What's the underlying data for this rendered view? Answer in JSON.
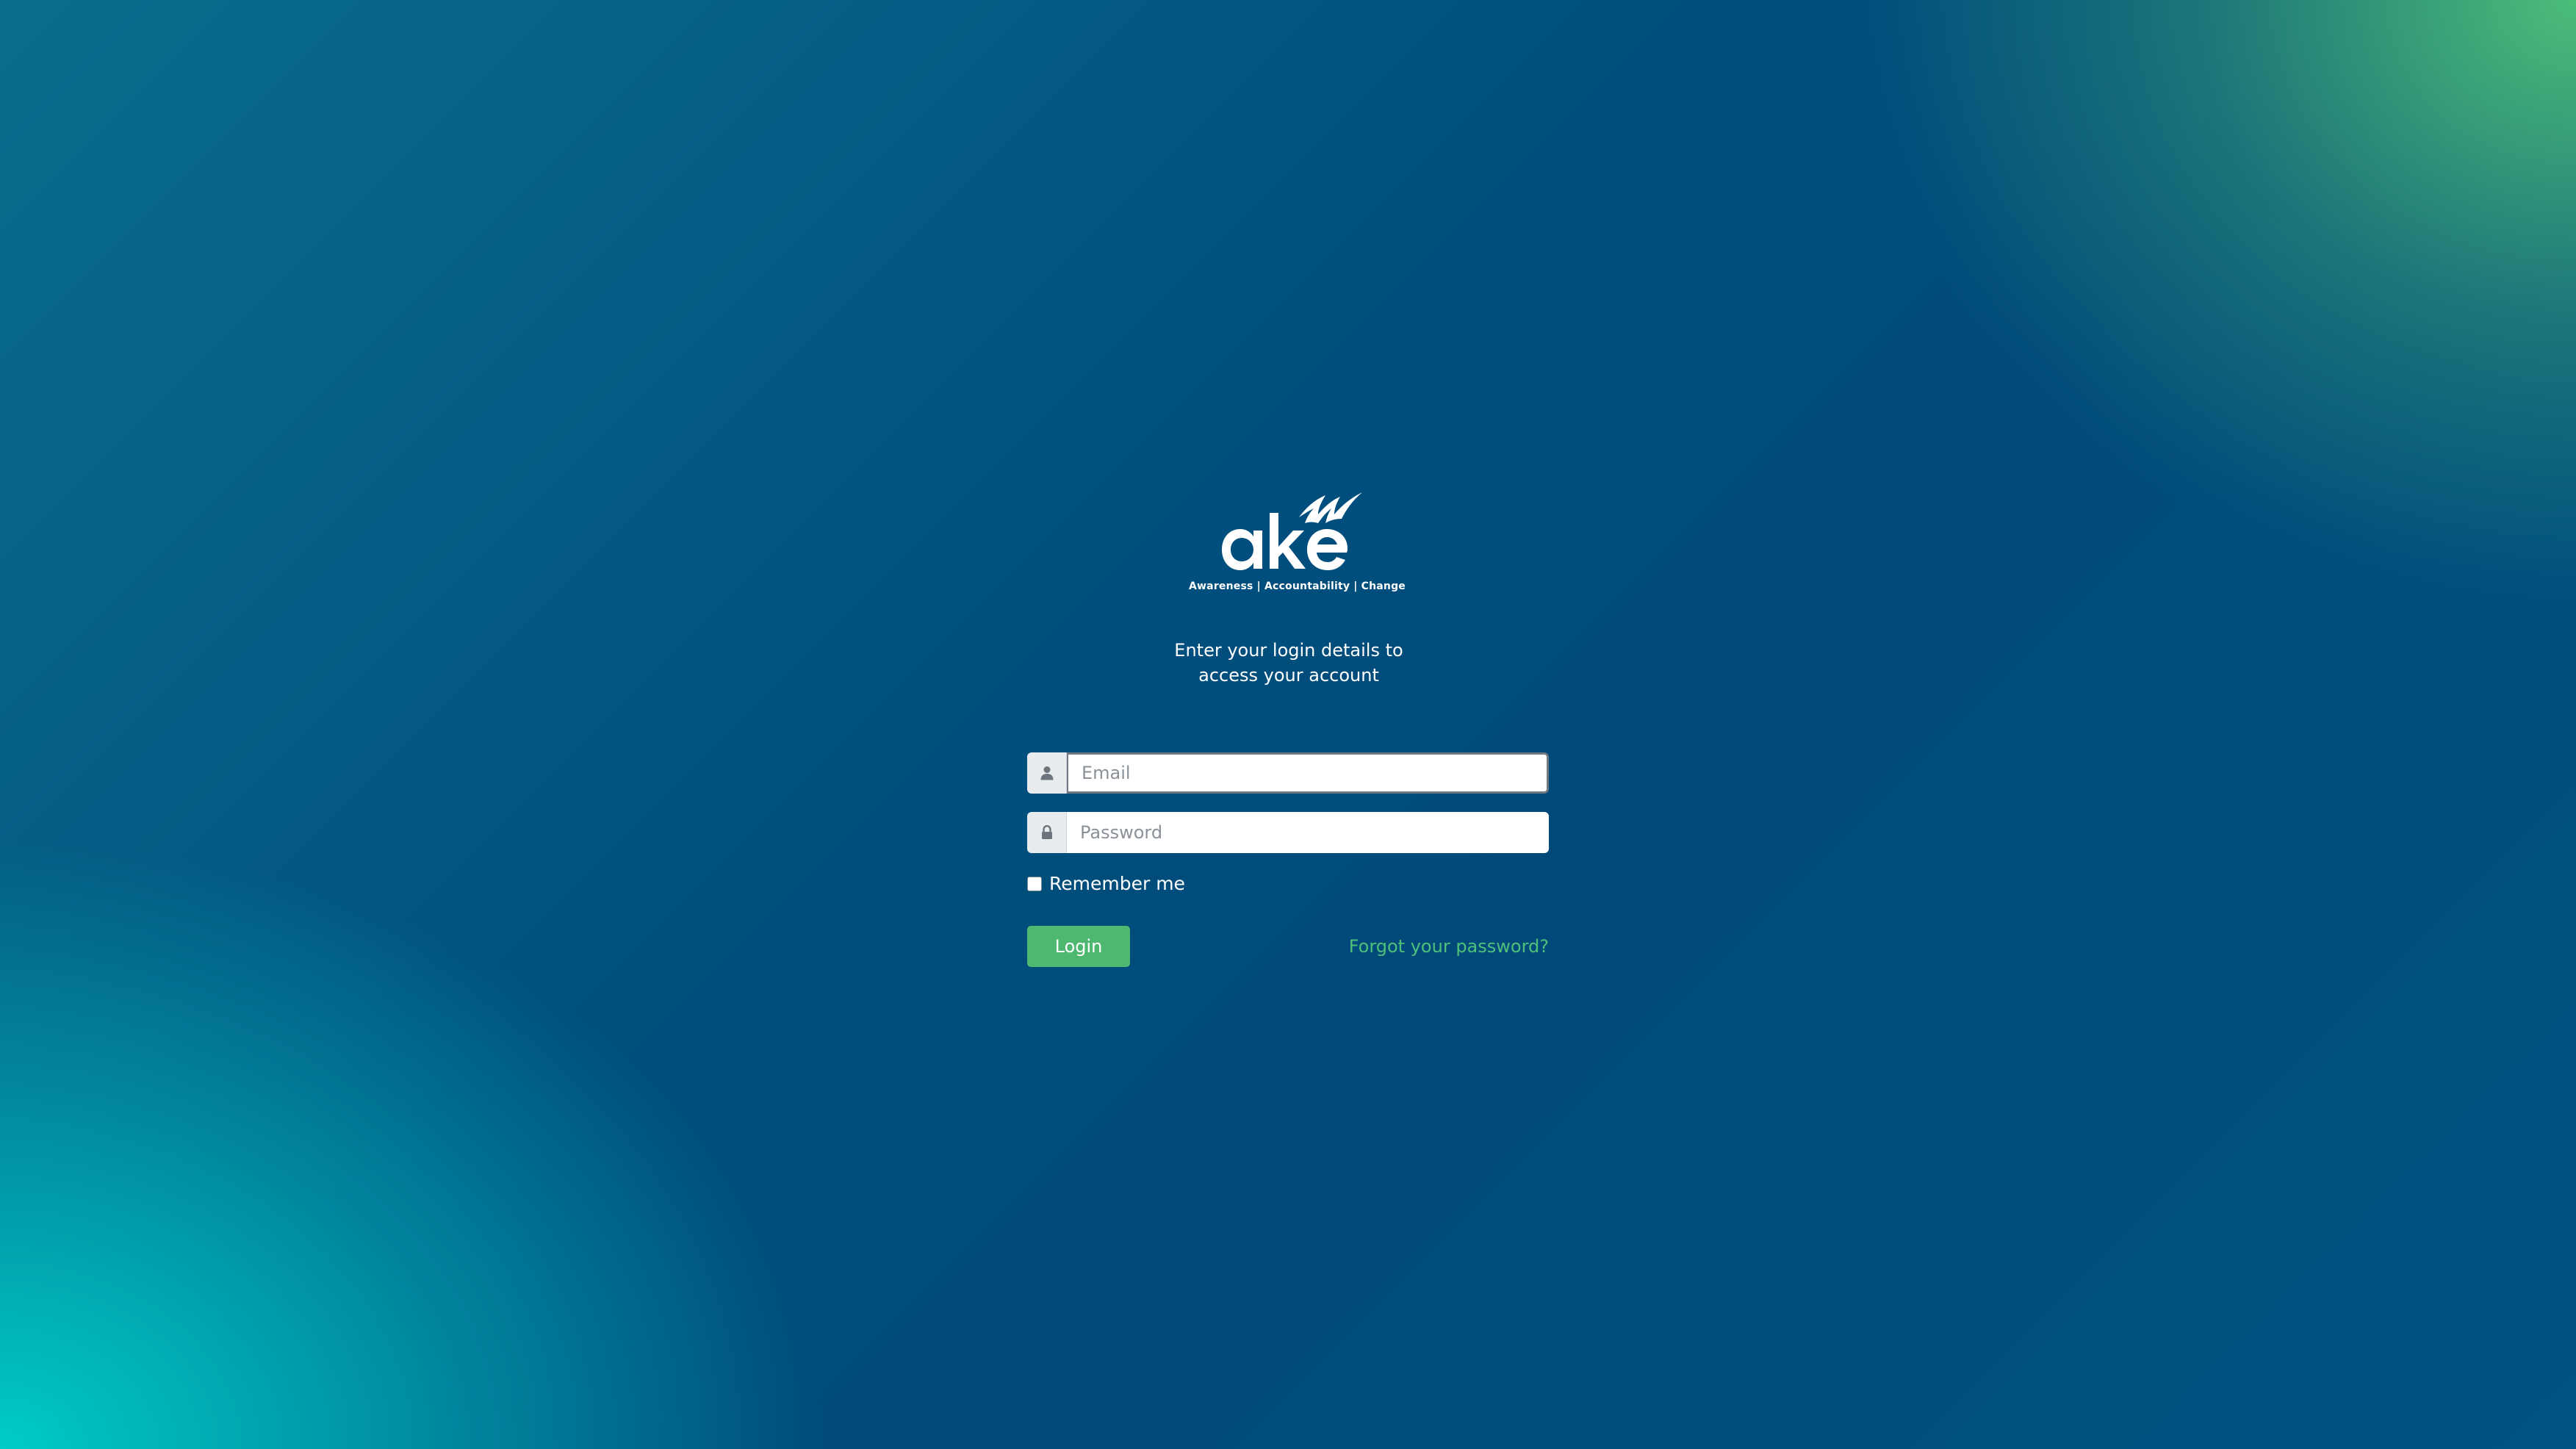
{
  "brand": {
    "logo_text": "ake",
    "tagline": "Awareness | Accountability | Change"
  },
  "intro": {
    "line1": "Enter your login details to",
    "line2": "access your account"
  },
  "form": {
    "email": {
      "icon": "user-icon",
      "placeholder": "Email",
      "value": ""
    },
    "password": {
      "icon": "lock-icon",
      "placeholder": "Password",
      "value": ""
    },
    "remember_label": "Remember me",
    "remember_checked": false,
    "login_label": "Login",
    "forgot_label": "Forgot your password?"
  },
  "colors": {
    "accent_green": "#4fb870",
    "link_green": "#4fc07a",
    "background_blue": "#004a7a",
    "background_teal": "#00d2c8"
  }
}
